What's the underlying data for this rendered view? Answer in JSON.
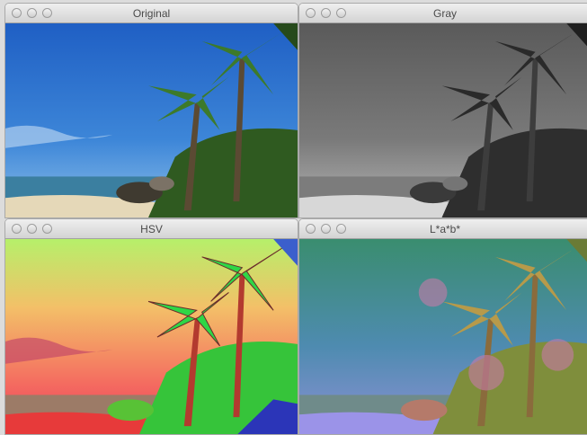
{
  "windows": [
    {
      "title": "Original"
    },
    {
      "title": "Gray"
    },
    {
      "title": "HSV"
    },
    {
      "title": "L*a*b*"
    }
  ]
}
